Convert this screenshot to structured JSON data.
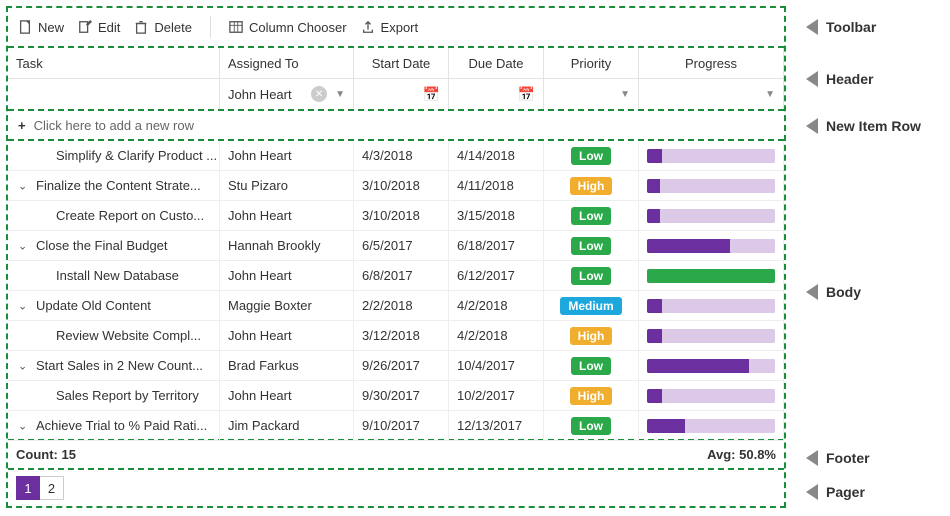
{
  "toolbar": {
    "new": "New",
    "edit": "Edit",
    "delete": "Delete",
    "column_chooser": "Column Chooser",
    "export": "Export"
  },
  "columns": {
    "task": "Task",
    "assigned": "Assigned To",
    "start": "Start Date",
    "due": "Due Date",
    "priority": "Priority",
    "progress": "Progress"
  },
  "filter": {
    "assigned_value": "John Heart"
  },
  "new_row_text": "Click here to add a new row",
  "rows": [
    {
      "task": "Simplify & Clarify Product ...",
      "assigned": "John Heart",
      "start": "4/3/2018",
      "due": "4/14/2018",
      "priority": "Low",
      "progress": 12,
      "indent": 1,
      "expander": false
    },
    {
      "task": "Finalize the Content Strate...",
      "assigned": "Stu Pizaro",
      "start": "3/10/2018",
      "due": "4/11/2018",
      "priority": "High",
      "progress": 10,
      "indent": 0,
      "expander": true
    },
    {
      "task": "Create Report on Custo...",
      "assigned": "John Heart",
      "start": "3/10/2018",
      "due": "3/15/2018",
      "priority": "Low",
      "progress": 10,
      "indent": 1,
      "expander": false
    },
    {
      "task": "Close the Final Budget",
      "assigned": "Hannah Brookly",
      "start": "6/5/2017",
      "due": "6/18/2017",
      "priority": "Low",
      "progress": 65,
      "indent": 0,
      "expander": true
    },
    {
      "task": "Install New Database",
      "assigned": "John Heart",
      "start": "6/8/2017",
      "due": "6/12/2017",
      "priority": "Low",
      "progress": 100,
      "indent": 1,
      "expander": false
    },
    {
      "task": "Update Old Content",
      "assigned": "Maggie Boxter",
      "start": "2/2/2018",
      "due": "4/2/2018",
      "priority": "Medium",
      "progress": 12,
      "indent": 0,
      "expander": true
    },
    {
      "task": "Review Website Compl...",
      "assigned": "John Heart",
      "start": "3/12/2018",
      "due": "4/2/2018",
      "priority": "High",
      "progress": 12,
      "indent": 1,
      "expander": false
    },
    {
      "task": "Start Sales in 2 New Count...",
      "assigned": "Brad Farkus",
      "start": "9/26/2017",
      "due": "10/4/2017",
      "priority": "Low",
      "progress": 80,
      "indent": 0,
      "expander": true
    },
    {
      "task": "Sales Report by Territory",
      "assigned": "John Heart",
      "start": "9/30/2017",
      "due": "10/2/2017",
      "priority": "High",
      "progress": 12,
      "indent": 1,
      "expander": false
    },
    {
      "task": "Achieve Trial to % Paid Rati...",
      "assigned": "Jim Packard",
      "start": "9/10/2017",
      "due": "12/13/2017",
      "priority": "Low",
      "progress": 30,
      "indent": 0,
      "expander": true
    }
  ],
  "footer": {
    "count_label": "Count:",
    "count_value": "15",
    "avg_label": "Avg:",
    "avg_value": "50.8%"
  },
  "pager": {
    "pages": [
      "1",
      "2"
    ],
    "active": 0
  },
  "labels": {
    "toolbar": "Toolbar",
    "header": "Header",
    "newrow": "New Item Row",
    "body": "Body",
    "footer": "Footer",
    "pager": "Pager"
  }
}
